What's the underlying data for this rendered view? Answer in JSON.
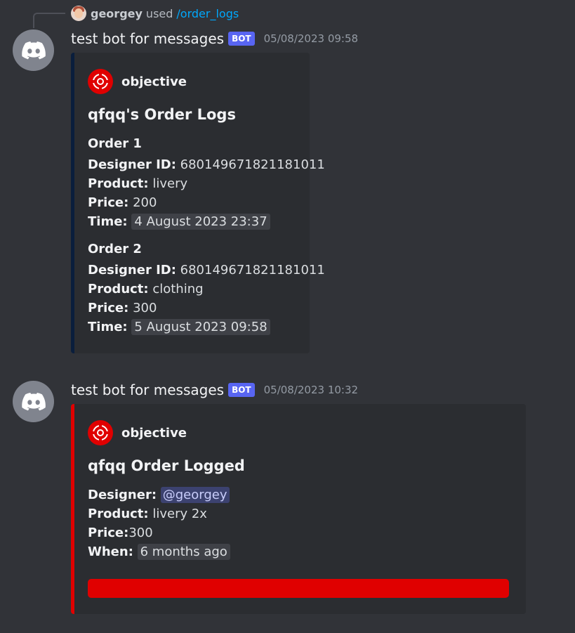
{
  "reply": {
    "user": "georgey",
    "verb": "used",
    "command": "/order_logs"
  },
  "messages": [
    {
      "author": "test bot for messages",
      "badge": "BOT",
      "timestamp": "05/08/2023 09:58",
      "embed": {
        "provider": "objective",
        "title": "qfqq's Order Logs",
        "accent_color": "#0a1e3c",
        "orders": [
          {
            "heading": "Order 1",
            "designer_id_label": "Designer ID:",
            "designer_id": "680149671821181011",
            "product_label": "Product:",
            "product": "livery",
            "price_label": "Price:",
            "price": "200",
            "time_label": "Time:",
            "time": "4 August 2023 23:37"
          },
          {
            "heading": "Order 2",
            "designer_id_label": "Designer ID:",
            "designer_id": "680149671821181011",
            "product_label": "Product:",
            "product": "clothing",
            "price_label": "Price:",
            "price": "300",
            "time_label": "Time:",
            "time": "5 August 2023 09:58"
          }
        ]
      }
    },
    {
      "author": "test bot for messages",
      "badge": "BOT",
      "timestamp": "05/08/2023 10:32",
      "embed": {
        "provider": "objective",
        "title": "qfqq Order Logged",
        "accent_color": "#e00000",
        "designer_label": "Designer:",
        "designer": "@georgey",
        "product_label": "Product:",
        "product": "livery 2x",
        "price_label": "Price:",
        "price": "300",
        "when_label": "When:",
        "when": "6 months ago"
      }
    }
  ],
  "colors": {
    "background": "#313338",
    "embed_bg": "#2b2d31",
    "bot_badge": "#5865f2",
    "brand_red": "#e00000"
  },
  "icons": {
    "avatar": "discord-logo-icon",
    "provider": "target-logo-icon"
  }
}
